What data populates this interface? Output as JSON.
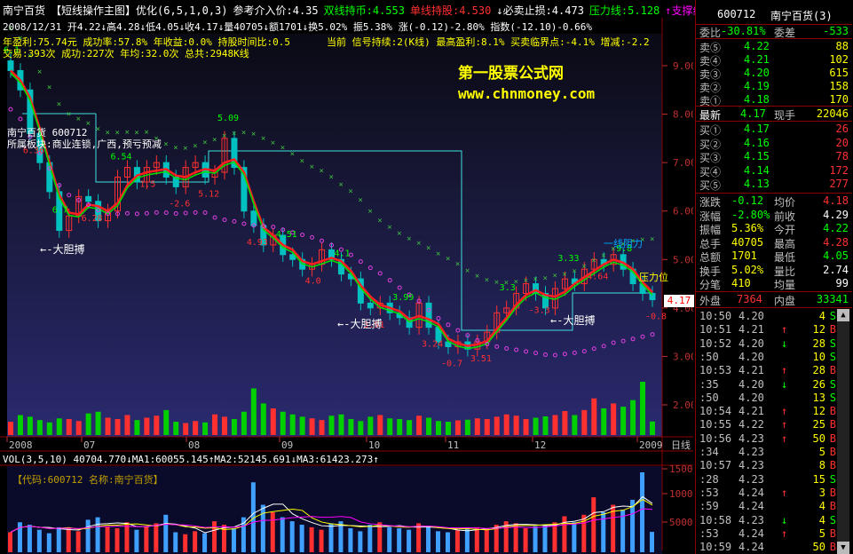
{
  "header": {
    "line1": [
      {
        "text": "南宁百货",
        "color": "#ffffff"
      },
      {
        "text": "【短线操作主图】优化(6,5,1,0,3)",
        "color": "#ffffff"
      },
      {
        "text": "参考介入价:4.35",
        "color": "#ffffff"
      },
      {
        "text": "双线持币:4.553",
        "color": "#00ff00"
      },
      {
        "text": "单线持股:4.530",
        "color": "#ff3030"
      },
      {
        "text": "↓必卖止损:4.473",
        "color": "#ffffff"
      },
      {
        "text": "压力线:5.128",
        "color": "#00ff00"
      },
      {
        "text": "↑支撑线",
        "color": "#ff00ff"
      },
      {
        "text": "↕日",
        "color": "#ff0000"
      }
    ],
    "line2": "2008/12/31  开4.22↓高4.28↓低4.05↓收4.17↓量40705↓额1701↓换5.02% 振5.38% 涨(-0.12)-2.80% 指数(-12.10)-0.66%",
    "line3": "年盈利:75.74元 成功率:57.8% 年收益:0.0% 持股时间比:0.5",
    "line3b": "当前 信号持续:2(K线) 最高盈利:8.1% 买卖临界点:-4.1% 增减:-2.2",
    "line4": "交易:393次 成功:227次 年均:32.0次 总共:2948K线"
  },
  "watermark": {
    "title": "第一股票公式网",
    "url": "www.chnmoney.com"
  },
  "stock_label": {
    "name": "南宁百货 600712",
    "sector": "所属板块:商业连锁,广西,预亏预减"
  },
  "annotations": [
    "大胆搏",
    "大胆搏",
    "大胆搏",
    "压力位",
    "一线阻力"
  ],
  "x_axis_labels": [
    "2008",
    "07",
    "08",
    "09",
    "10",
    "11",
    "12",
    "2009",
    "日线"
  ],
  "volume_panel": {
    "header": "VOL(3,5,10)  40704.770↓MA1:60055.145↑MA2:52145.691↓MA3:61423.273↑",
    "code_label": "【代码:600712 名称:南宁百货】",
    "y_labels": [
      "150000",
      "100000",
      "50000"
    ]
  },
  "current_price_tag": "4.17",
  "chart_data": {
    "type": "candlestick",
    "title": "南宁百货 600712 日线",
    "y_ticks": [
      9.0,
      8.0,
      7.0,
      6.0,
      5.0,
      4.0,
      3.0,
      2.0
    ],
    "ylim": [
      1.8,
      9.9
    ],
    "series": [
      {
        "name": "收盘",
        "values": [
          8.9,
          8.5,
          7.6,
          7.0,
          6.4,
          5.6,
          5.9,
          6.3,
          6.2,
          5.8,
          6.0,
          6.7,
          6.9,
          6.6,
          6.9,
          7.0,
          6.7,
          6.5,
          6.9,
          7.0,
          6.7,
          6.8,
          7.5,
          6.9,
          6.0,
          5.7,
          5.3,
          5.5,
          5.1,
          5.0,
          4.8,
          4.9,
          5.2,
          5.0,
          4.7,
          4.6,
          4.1,
          4.0,
          4.1,
          3.9,
          3.8,
          3.6,
          4.1,
          3.6,
          3.3,
          3.2,
          3.3,
          3.15,
          3.3,
          3.5,
          3.9,
          4.0,
          4.3,
          4.5,
          4.3,
          4.0,
          4.4,
          4.6,
          4.5,
          4.8,
          5.0,
          4.9,
          5.1,
          4.8,
          4.5,
          4.3,
          4.17
        ]
      }
    ],
    "markers": [
      "6.1",
      "6.36",
      "6.7",
      "6.28",
      "6.54",
      "1.5",
      "-2.6",
      "5.12",
      "5.09",
      "4.93",
      "4.51",
      "4.0",
      "4.1",
      "3.91",
      "3.99",
      "3.24",
      "-0.7",
      "3.51",
      "3.3",
      "-3.3",
      "3.33",
      "4.64",
      "9.8",
      "-0.8"
    ],
    "volume": {
      "values": [
        40,
        60,
        55,
        45,
        38,
        50,
        48,
        42,
        65,
        70,
        52,
        48,
        60,
        45,
        52,
        58,
        75,
        40,
        36,
        42,
        38,
        62,
        55,
        48,
        70,
        140,
        95,
        80,
        70,
        62,
        55,
        50,
        45,
        58,
        62,
        48,
        42,
        55,
        60,
        50,
        48,
        45,
        58,
        52,
        42,
        40,
        44,
        46,
        50,
        48,
        55,
        62,
        58,
        48,
        52,
        56,
        60,
        72,
        60,
        75,
        110,
        80,
        95,
        85,
        105,
        160,
        40.7
      ],
      "ma1": 60055.145,
      "ma2": 52145.691,
      "ma3": 61423.273,
      "ylim": [
        0,
        160000
      ]
    }
  },
  "right_panel": {
    "title": {
      "code": "600712",
      "name": "南宁百货(3)"
    },
    "webi": {
      "label": "委比",
      "pct": "-30.81%",
      "label2": "委差",
      "val": "-533"
    },
    "sell": [
      {
        "label": "卖⑤",
        "price": "4.22",
        "vol": "88"
      },
      {
        "label": "卖④",
        "price": "4.21",
        "vol": "102"
      },
      {
        "label": "卖③",
        "price": "4.20",
        "vol": "615"
      },
      {
        "label": "卖②",
        "price": "4.19",
        "vol": "158"
      },
      {
        "label": "卖①",
        "price": "4.18",
        "vol": "170"
      }
    ],
    "latest": {
      "label": "最新",
      "price": "4.17",
      "label2": "现手",
      "val": "22046"
    },
    "buy": [
      {
        "label": "买①",
        "price": "4.17",
        "vol": "26"
      },
      {
        "label": "买②",
        "price": "4.16",
        "vol": "20"
      },
      {
        "label": "买③",
        "price": "4.15",
        "vol": "78"
      },
      {
        "label": "买④",
        "price": "4.14",
        "vol": "172"
      },
      {
        "label": "买⑤",
        "price": "4.13",
        "vol": "277"
      }
    ],
    "stats": [
      {
        "l1": "涨跌",
        "v1": "-0.12",
        "l2": "均价",
        "v2": "4.18"
      },
      {
        "l1": "涨幅",
        "v1": "-2.80%",
        "l2": "前收",
        "v2": "4.29"
      },
      {
        "l1": "振幅",
        "v1": "5.36%",
        "l2": "今开",
        "v2": "4.22"
      },
      {
        "l1": "总手",
        "v1": "40705",
        "l2": "最高",
        "v2": "4.28"
      },
      {
        "l1": "总额",
        "v1": "1701",
        "l2": "最低",
        "v2": "4.05"
      },
      {
        "l1": "换手",
        "v1": "5.02%",
        "l2": "量比",
        "v2": "2.74"
      },
      {
        "l1": "分笔",
        "v1": "410",
        "l2": "均量",
        "v2": "99"
      }
    ],
    "outer": {
      "label": "外盘",
      "val": "7364",
      "label2": "内盘",
      "val2": "33341"
    },
    "ticks": [
      {
        "time": "10:50",
        "price": "4.20",
        "arrow": "",
        "vol": "4",
        "bs": "S"
      },
      {
        "time": "10:51",
        "price": "4.21",
        "arrow": "↑",
        "vol": "12",
        "bs": "B"
      },
      {
        "time": "10:52",
        "price": "4.20",
        "arrow": "↓",
        "vol": "28",
        "bs": "S"
      },
      {
        "time": ":50",
        "price": "4.20",
        "arrow": "",
        "vol": "10",
        "bs": "S"
      },
      {
        "time": "10:53",
        "price": "4.21",
        "arrow": "↑",
        "vol": "28",
        "bs": "B"
      },
      {
        "time": ":35",
        "price": "4.20",
        "arrow": "↓",
        "vol": "26",
        "bs": "S"
      },
      {
        "time": ":50",
        "price": "4.20",
        "arrow": "",
        "vol": "13",
        "bs": "S"
      },
      {
        "time": "10:54",
        "price": "4.21",
        "arrow": "↑",
        "vol": "12",
        "bs": "B"
      },
      {
        "time": "10:55",
        "price": "4.22",
        "arrow": "↑",
        "vol": "25",
        "bs": "B"
      },
      {
        "time": "10:56",
        "price": "4.23",
        "arrow": "↑",
        "vol": "50",
        "bs": "B"
      },
      {
        "time": ":34",
        "price": "4.23",
        "arrow": "",
        "vol": "5",
        "bs": "B"
      },
      {
        "time": "10:57",
        "price": "4.23",
        "arrow": "",
        "vol": "8",
        "bs": "B"
      },
      {
        "time": ":28",
        "price": "4.23",
        "arrow": "",
        "vol": "15",
        "bs": "S"
      },
      {
        "time": ":53",
        "price": "4.24",
        "arrow": "↑",
        "vol": "3",
        "bs": "B"
      },
      {
        "time": ":59",
        "price": "4.24",
        "arrow": "",
        "vol": "4",
        "bs": "B"
      },
      {
        "time": "10:58",
        "price": "4.23",
        "arrow": "↓",
        "vol": "4",
        "bs": "S"
      },
      {
        "time": ":53",
        "price": "4.24",
        "arrow": "↑",
        "vol": "5",
        "bs": "B"
      },
      {
        "time": "10:59",
        "price": "4.24",
        "arrow": "",
        "vol": "50",
        "bs": "B"
      }
    ]
  }
}
